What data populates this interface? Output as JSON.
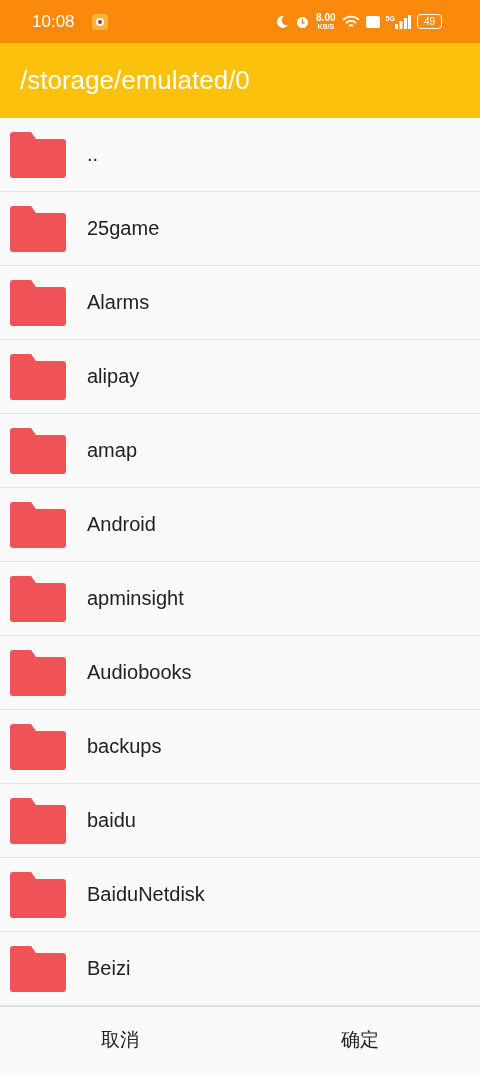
{
  "status_bar": {
    "time": "10:08",
    "net_speed": "8.00",
    "net_unit": "KB/S",
    "network": "5G",
    "battery": "49"
  },
  "title": "/storage/emulated/0",
  "folders": [
    {
      "name": ".."
    },
    {
      "name": "25game"
    },
    {
      "name": "Alarms"
    },
    {
      "name": "alipay"
    },
    {
      "name": "amap"
    },
    {
      "name": "Android"
    },
    {
      "name": "apminsight"
    },
    {
      "name": "Audiobooks"
    },
    {
      "name": "backups"
    },
    {
      "name": "baidu"
    },
    {
      "name": "BaiduNetdisk"
    },
    {
      "name": "Beizi"
    }
  ],
  "buttons": [
    "取消",
    "确定"
  ]
}
